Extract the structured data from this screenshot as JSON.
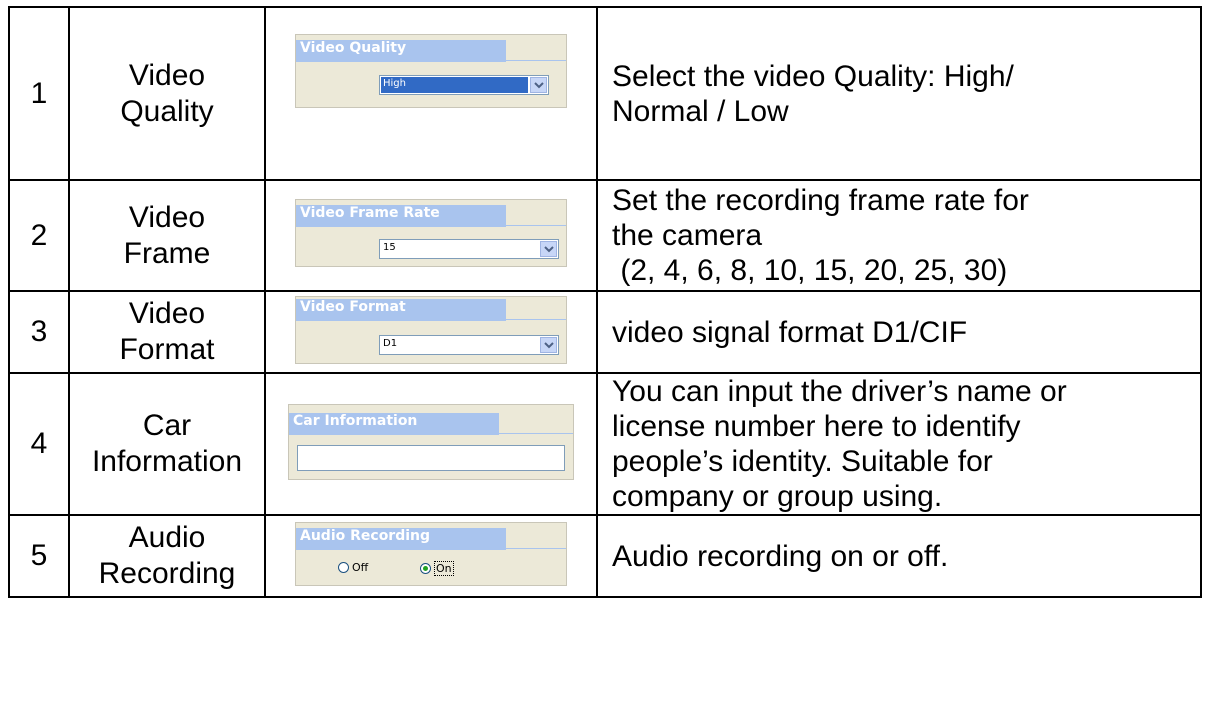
{
  "rows": [
    {
      "num": "1",
      "name_line1": "Video",
      "name_line2": "Quality",
      "widget": {
        "header": "Video Quality",
        "value": "High"
      },
      "desc_lines": [
        "Select the video Quality: High/",
        "Normal / Low"
      ]
    },
    {
      "num": "2",
      "name_line1": "Video",
      "name_line2": "Frame",
      "widget": {
        "header": "Video Frame Rate",
        "value": "15"
      },
      "desc_lines": [
        "Set the recording frame rate for",
        "the camera",
        " (2, 4, 6, 8, 10, 15, 20, 25, 30)"
      ]
    },
    {
      "num": "3",
      "name_line1": "Video",
      "name_line2": "Format",
      "widget": {
        "header": "Video Format",
        "value": "D1"
      },
      "desc_lines": [
        "video signal format D1/CIF"
      ]
    },
    {
      "num": "4",
      "name_line1": "Car",
      "name_line2": "Information",
      "widget": {
        "header": "Car Information",
        "value": ""
      },
      "desc_lines": [
        "You can input the driver’s name or",
        "license number here to identify",
        "people’s identity. Suitable for",
        "company or group using."
      ]
    },
    {
      "num": "5",
      "name_line1": "Audio",
      "name_line2": "Recording",
      "widget": {
        "header": "Audio Recording",
        "option_off": "Off",
        "option_on": "On",
        "selected": "On"
      },
      "desc_lines": [
        "Audio recording on or off."
      ]
    }
  ],
  "colors": {
    "header_band": "#a9c4ee",
    "panel_bg": "#ece9d8",
    "selection": "#316ac5"
  },
  "icons": {
    "dropdown": "chevron-down-icon",
    "radio": "radio-button-icon"
  }
}
